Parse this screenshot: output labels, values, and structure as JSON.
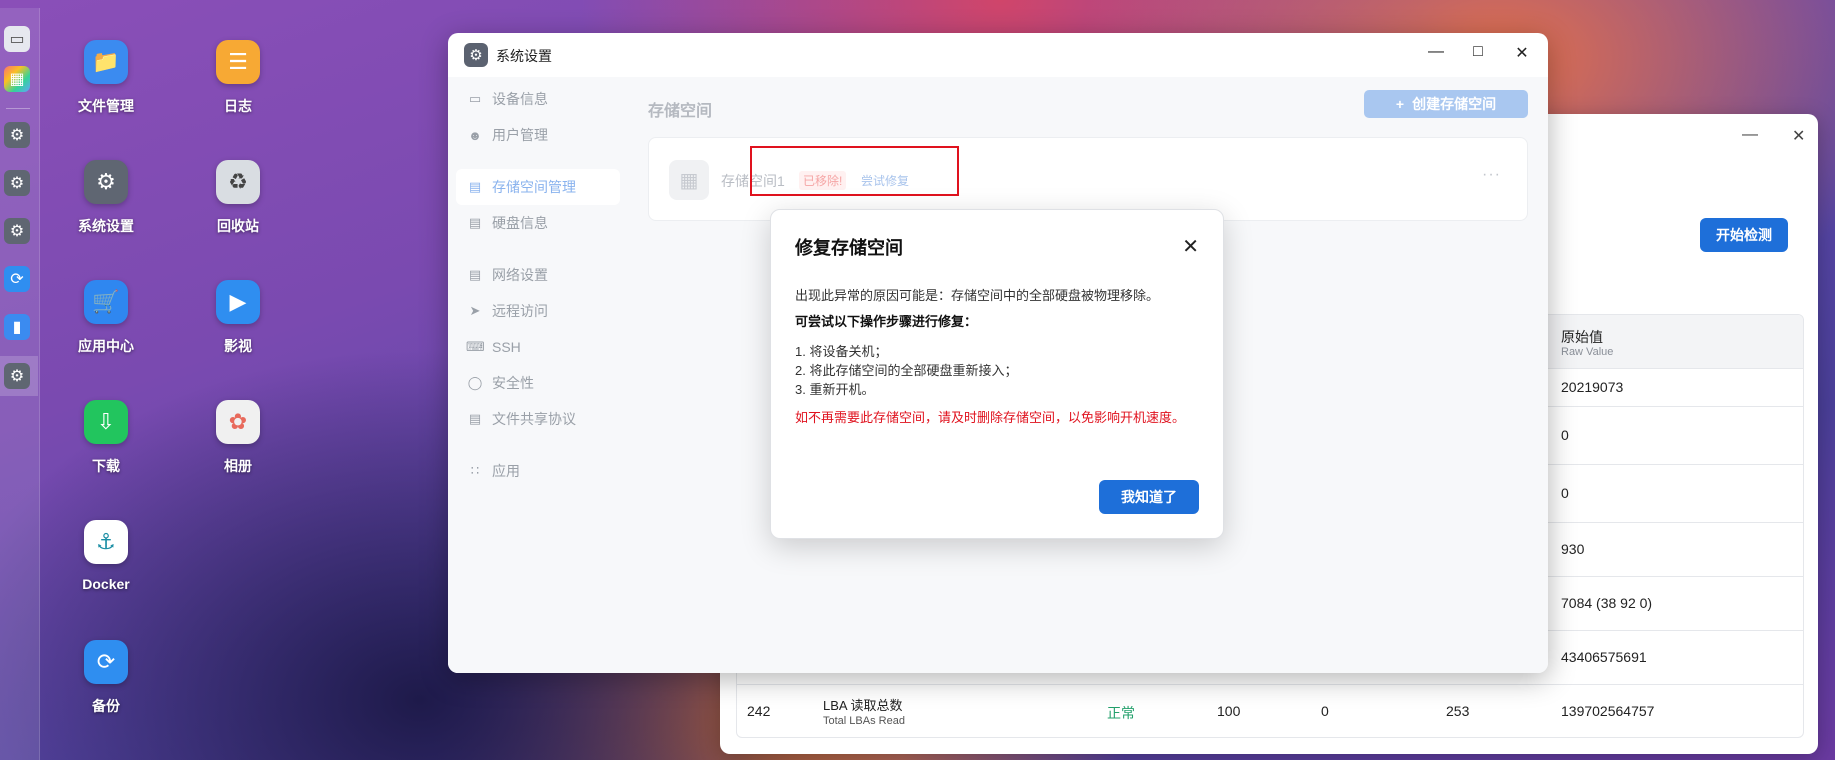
{
  "dock": {
    "items": [
      "monitor-icon",
      "apps-icon",
      "gear-icon",
      "gear-icon",
      "gear-icon",
      "sync-icon",
      "folder-icon",
      "gear-icon"
    ]
  },
  "desktop": {
    "icons": [
      {
        "label": "文件管理",
        "icon": "folder-icon",
        "color": "#3b8bf0"
      },
      {
        "label": "日志",
        "icon": "log-icon",
        "color": "#f7a934"
      },
      {
        "label": "系统设置",
        "icon": "gear-icon",
        "color": "#5f6672"
      },
      {
        "label": "回收站",
        "icon": "recycle-icon",
        "color": "#d9dde2"
      },
      {
        "label": "应用中心",
        "icon": "store-icon",
        "color": "#2f87f0"
      },
      {
        "label": "影视",
        "icon": "video-icon",
        "color": "#2f8ef0"
      },
      {
        "label": "下载",
        "icon": "download-icon",
        "color": "#22c55e"
      },
      {
        "label": "相册",
        "icon": "photos-icon",
        "color": "#f0f0f0"
      },
      {
        "label": "Docker",
        "icon": "docker-icon",
        "color": "#ffffff"
      },
      {
        "label": "备份",
        "icon": "backup-icon",
        "color": "#2f8ef0"
      }
    ]
  },
  "bg_window": {
    "start_check": "开始检测",
    "raw_value_header": "原始值",
    "raw_value_header_en": "Raw Value",
    "rows": [
      {
        "raw": "20219073"
      },
      {
        "raw": "0"
      },
      {
        "raw": "0"
      },
      {
        "raw": "930"
      },
      {
        "raw": "7084 (38 92 0)"
      },
      {
        "raw": "43406575691"
      }
    ],
    "last_row": {
      "id": "242",
      "name": "LBA 读取总数",
      "name_en": "Total LBAs Read",
      "status": "正常",
      "value": "100",
      "worst": "0",
      "threshold": "253",
      "raw": "139702564757"
    }
  },
  "window": {
    "title": "系统设置",
    "sidebar": [
      {
        "label": "设备信息",
        "icon": "device-icon"
      },
      {
        "label": "用户管理",
        "icon": "user-icon"
      },
      {
        "label": "存储空间管理",
        "icon": "storage-icon",
        "active": true
      },
      {
        "label": "硬盘信息",
        "icon": "disk-icon"
      },
      {
        "label": "网络设置",
        "icon": "network-icon"
      },
      {
        "label": "远程访问",
        "icon": "remote-icon"
      },
      {
        "label": "SSH",
        "icon": "ssh-icon"
      },
      {
        "label": "安全性",
        "icon": "shield-icon"
      },
      {
        "label": "文件共享协议",
        "icon": "share-icon"
      },
      {
        "label": "应用",
        "icon": "apps-icon"
      }
    ],
    "page_title": "存储空间",
    "create_button": "创建存储空间",
    "pool": {
      "name": "存储空间1",
      "removed_badge": "已移除!",
      "repair_link": "尝试修复",
      "more": "···"
    }
  },
  "modal": {
    "title": "修复存储空间",
    "cause": "出现此异常的原因可能是：存储空间中的全部硬盘被物理移除。",
    "steps_heading": "可尝试以下操作步骤进行修复：",
    "steps": [
      "1. 将设备关机；",
      "2. 将此存储空间的全部硬盘重新接入；",
      "3. 重新开机。"
    ],
    "warning": "如不再需要此存储空间，请及时删除存储空间，以免影响开机速度。",
    "ok_button": "我知道了"
  },
  "colors": {
    "primary": "#1e6fd9",
    "danger": "#e0121e",
    "ok": "#22a06b"
  }
}
